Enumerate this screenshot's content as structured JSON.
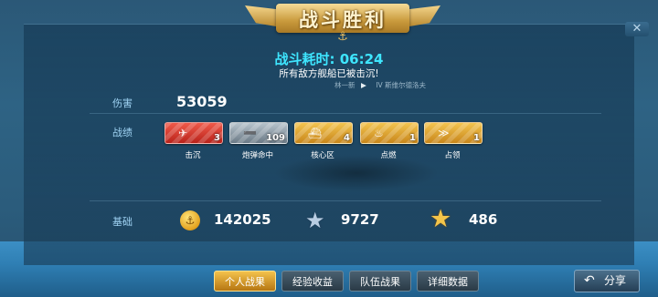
{
  "banner": {
    "title": "战斗胜利"
  },
  "battle": {
    "time_label": "战斗耗时:",
    "time_value": "06:24",
    "message": "所有敌方舰船已被击沉!",
    "player_name": "林一新",
    "ship_tier": "IV",
    "ship_name": "斯维尔德洛夫"
  },
  "stats": {
    "damage_label": "伤害",
    "damage_value": "53059",
    "achievements_label": "战绩",
    "base_label": "基础"
  },
  "achievements": [
    {
      "name": "击沉",
      "count": "3",
      "color": "#d63a2e",
      "icon": "sunk-ship-icon"
    },
    {
      "name": "炮弹命中",
      "count": "109",
      "color": "#8e9ba6",
      "icon": "shell-icon"
    },
    {
      "name": "核心区",
      "count": "4",
      "color": "#e0a530",
      "icon": "citadel-icon"
    },
    {
      "name": "点燃",
      "count": "1",
      "color": "#e0a530",
      "icon": "fire-icon"
    },
    {
      "name": "占领",
      "count": "1",
      "color": "#e0a530",
      "icon": "capture-icon"
    }
  ],
  "rewards": {
    "credits": "142025",
    "experience": "9727",
    "commander_xp": "486"
  },
  "tabs": [
    {
      "label": "个人战果",
      "active": true
    },
    {
      "label": "经验收益",
      "active": false
    },
    {
      "label": "队伍战果",
      "active": false
    },
    {
      "label": "详细数据",
      "active": false
    }
  ],
  "share": {
    "label": "分享"
  }
}
